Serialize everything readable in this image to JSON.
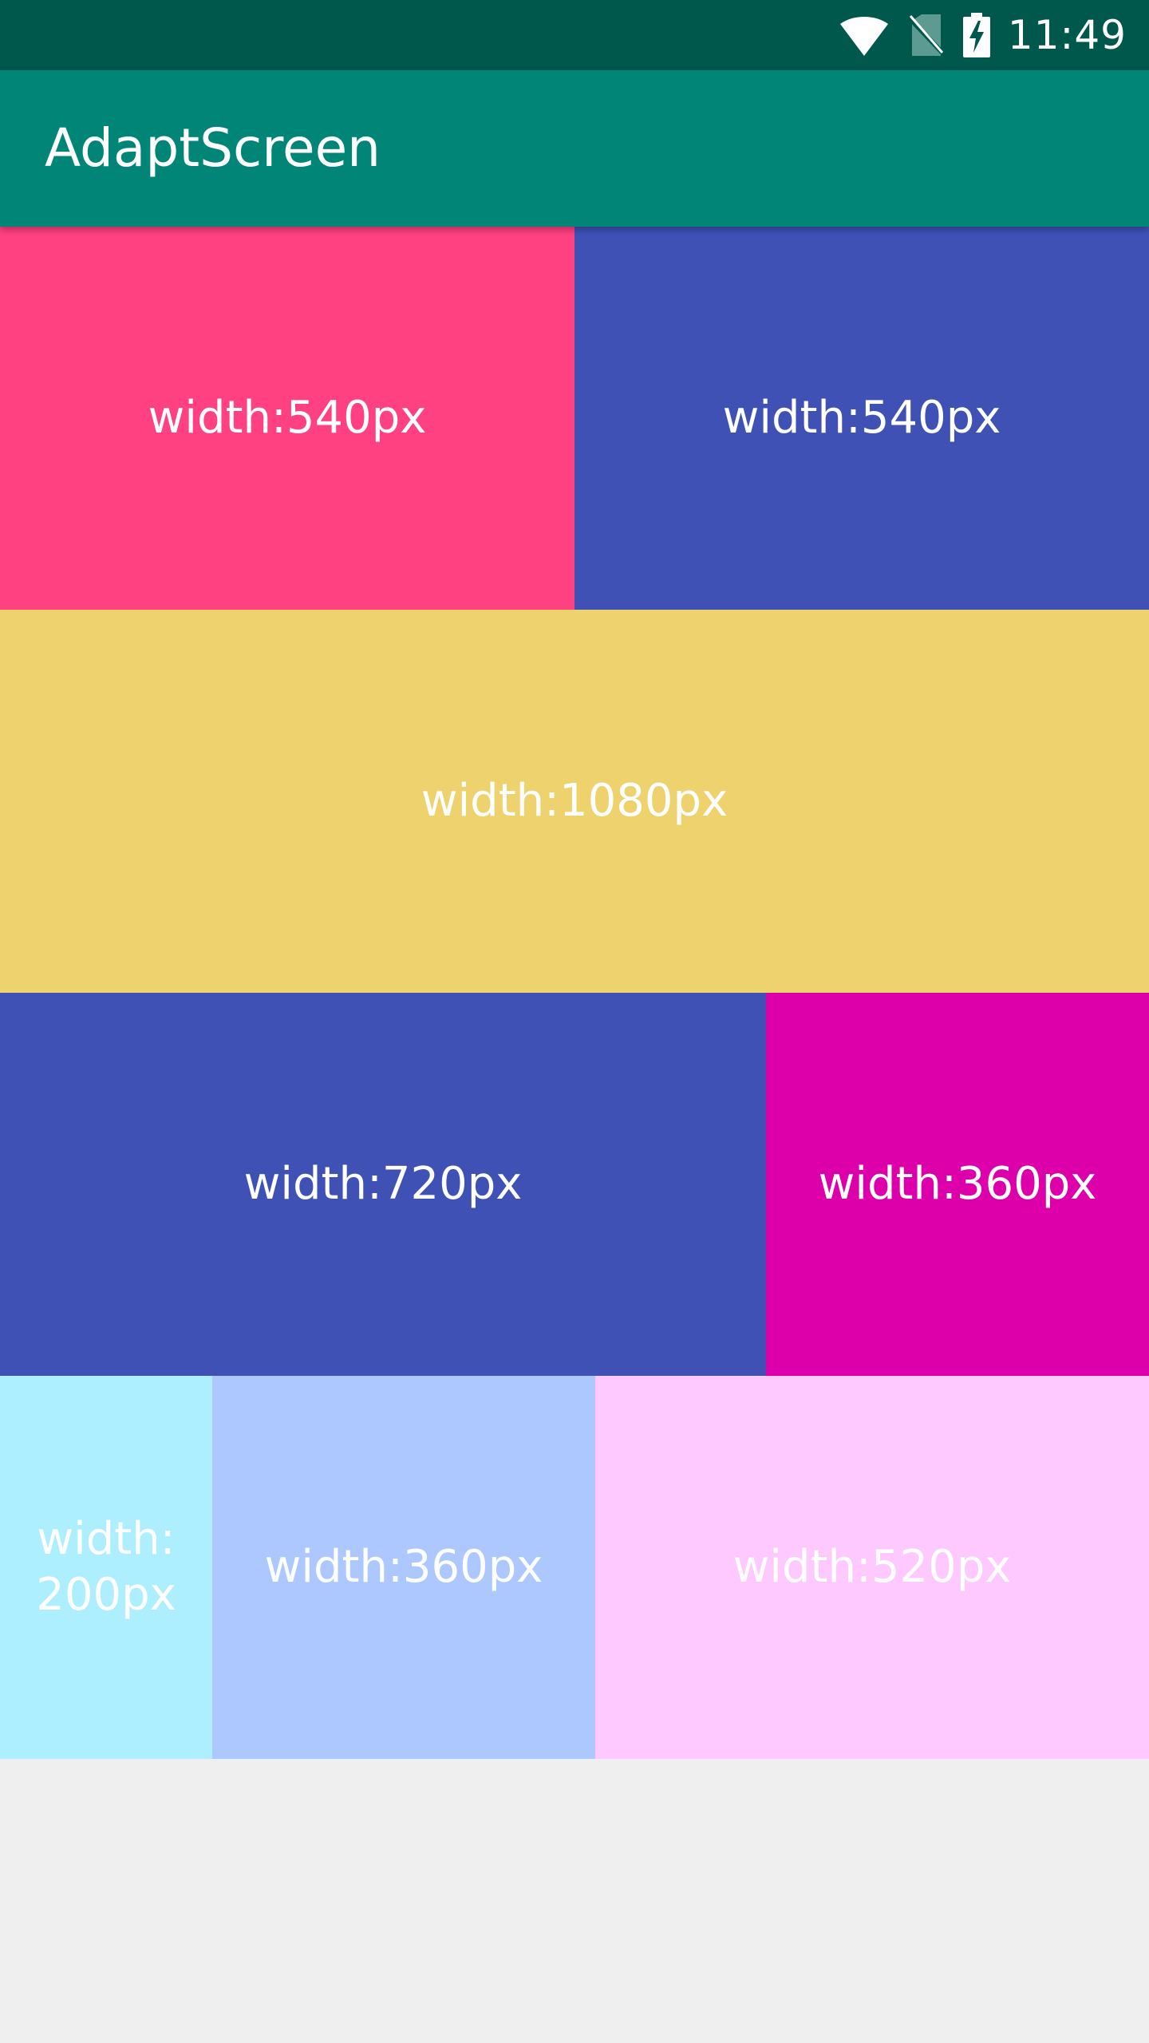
{
  "status_bar": {
    "time": "11:49",
    "icons": [
      "wifi-icon",
      "no-sim-icon",
      "battery-charging-icon"
    ],
    "color": "#00574b"
  },
  "app_bar": {
    "title": "AdaptScreen",
    "color": "#008577"
  },
  "rows": [
    {
      "cells": [
        {
          "label": "width:540px",
          "color": "#ff4081"
        },
        {
          "label": "width:540px",
          "color": "#3f51b5"
        }
      ]
    },
    {
      "cells": [
        {
          "label": "width:1080px",
          "color": "#edd26e"
        }
      ]
    },
    {
      "cells": [
        {
          "label": "width:720px",
          "color": "#3f51b5"
        },
        {
          "label": "width:360px",
          "color": "#dd00aa"
        }
      ]
    },
    {
      "cells": [
        {
          "label": "width: 200px",
          "color": "#adefff"
        },
        {
          "label": "width:360px",
          "color": "#acc8ff"
        },
        {
          "label": "width:520px",
          "color": "#fdc9ff"
        }
      ]
    }
  ],
  "background": "#efefef"
}
